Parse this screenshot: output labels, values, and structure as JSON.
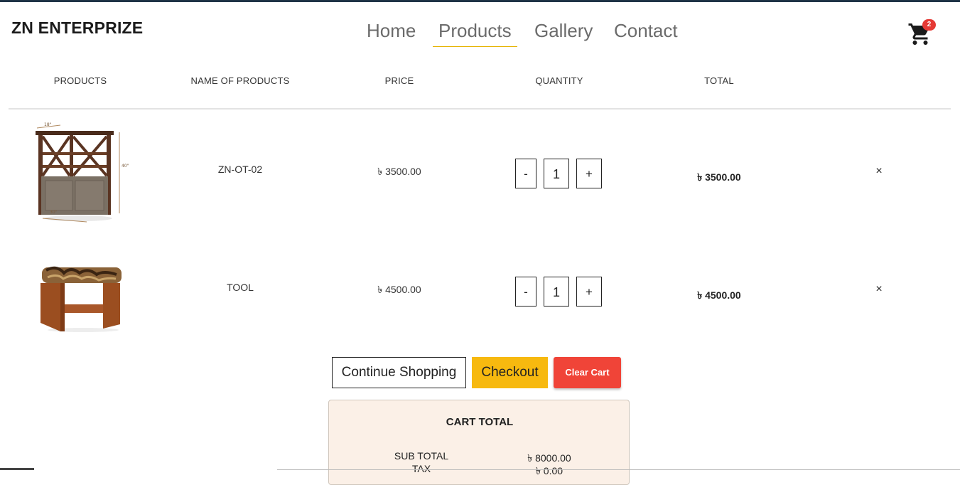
{
  "brand": "ZN ENTERPRIZE",
  "nav": {
    "items": [
      {
        "label": "Home"
      },
      {
        "label": "Products"
      },
      {
        "label": "Gallery"
      },
      {
        "label": "Contact"
      }
    ],
    "active": "Products"
  },
  "cart": {
    "icon": "cart-icon",
    "badge_count": "2"
  },
  "table": {
    "headers": [
      "PRODUCTS",
      "NAME OF PRODUCTS",
      "PRICE",
      "QUANTITY",
      "TOTAL"
    ],
    "rows": [
      {
        "image": "wooden-shelf-cabinet",
        "name": "ZN-OT-02",
        "price": "৳ 3500.00",
        "quantity": "1",
        "total": "৳ 3500.00",
        "minus": "-",
        "plus": "+",
        "remove": "×"
      },
      {
        "image": "cushioned-wooden-stool",
        "name": "TOOL",
        "price": "৳ 4500.00",
        "quantity": "1",
        "total": "৳ 4500.00",
        "minus": "-",
        "plus": "+",
        "remove": "×"
      }
    ]
  },
  "actions": {
    "continue_label": "Continue Shopping",
    "checkout_label": "Checkout",
    "clear_label": "Clear Cart"
  },
  "cart_total": {
    "title": "CART TOTAL",
    "subtotal_label": "SUB TOTAL",
    "subtotal_value": "৳ 8000.00",
    "tax_label": "TAX",
    "tax_value": "৳ 0.00"
  },
  "colors": {
    "accent_yellow": "#f7b90f",
    "danger_red": "#f04438",
    "panel_bg": "#fbf0e7",
    "top_bar": "#1e3346"
  }
}
